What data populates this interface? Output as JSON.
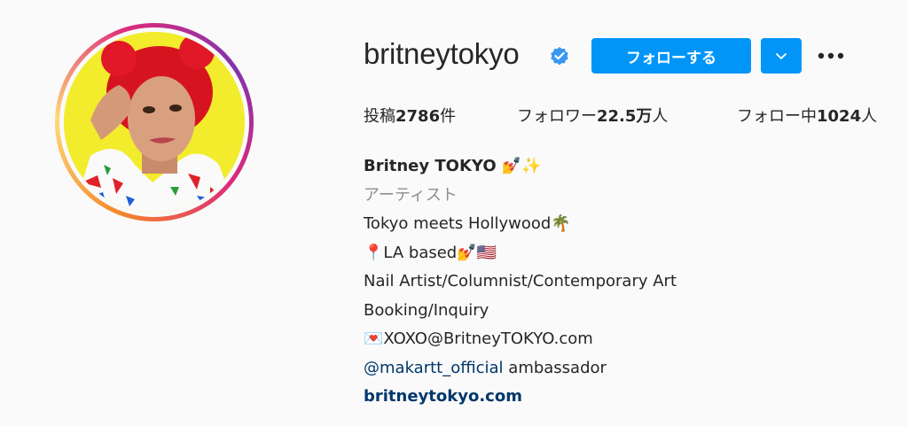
{
  "profile": {
    "username": "britneytokyo",
    "verified_icon": "verified-badge-icon",
    "follow_label": "フォローする",
    "dropdown_icon": "chevron-down-icon",
    "more_icon": "more-options-icon",
    "avatar_icon": "profile-picture"
  },
  "stats": {
    "posts_label": "投稿",
    "posts_count": "2786",
    "posts_unit": "件",
    "followers_label": "フォロワー",
    "followers_count": "22.5万",
    "followers_unit": "人",
    "following_label": "フォロー中",
    "following_count": "1024",
    "following_unit": "人"
  },
  "bio": {
    "full_name": "Britney TOKYO 💅✨",
    "category": "アーティスト",
    "lines": [
      "Tokyo meets Hollywood🌴",
      "📍LA based💅🇺🇸",
      "Nail Artist/Columnist/Contemporary Art",
      "Booking/Inquiry",
      "💌XOXO@BritneyTOKYO.com"
    ],
    "mention": "@makartt_official",
    "mention_suffix": " ambassador",
    "website": "britneytokyo.com"
  },
  "colors": {
    "accent": "#0095f6",
    "link": "#00376b",
    "muted": "#8e8e8e",
    "text": "#262626",
    "background": "#fafafa"
  }
}
